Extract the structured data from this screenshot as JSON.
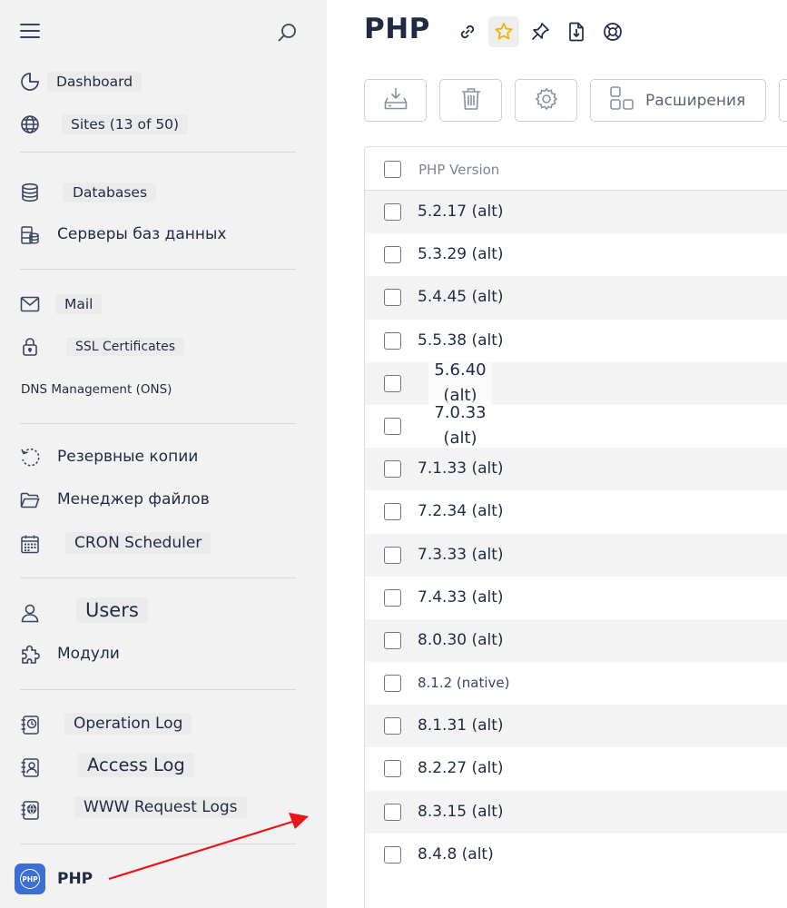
{
  "sidebar": {
    "items": [
      {
        "label": "Dashboard",
        "icon": "pie-chart-icon"
      },
      {
        "label": "Sites (13 of 50)",
        "icon": "globe-icon"
      },
      {
        "label": "Databases",
        "icon": "database-icon"
      },
      {
        "label": "Серверы баз данных",
        "icon": "database-server-icon"
      },
      {
        "label": "Mail",
        "icon": "envelope-icon"
      },
      {
        "label": "SSL Certificates",
        "icon": "lock-icon"
      },
      {
        "label": "DNS Management (ONS)",
        "icon": ""
      },
      {
        "label": "Резервные копии",
        "icon": "backup-icon"
      },
      {
        "label": "Менеджер файлов",
        "icon": "folder-icon"
      },
      {
        "label": "CRON Scheduler",
        "icon": "calendar-icon"
      },
      {
        "label": "Users",
        "icon": "user-icon"
      },
      {
        "label": "Модули",
        "icon": "puzzle-icon"
      },
      {
        "label": "Operation Log",
        "icon": "log-clock-icon"
      },
      {
        "label": "Access Log",
        "icon": "log-user-icon"
      },
      {
        "label": "WWW Request Logs",
        "icon": "log-globe-icon"
      },
      {
        "label": "PHP",
        "icon": "php-icon"
      }
    ],
    "php_badge_text": "PHP"
  },
  "main": {
    "title": "PHP",
    "extensions_label": "Расширения",
    "table": {
      "header": "PHP Version",
      "rows": [
        "5.2.17 (alt)",
        "5.3.29 (alt)",
        "5.4.45 (alt)",
        "5.5.38 (alt)",
        "5.6.40 (alt)",
        "7.0.33 (alt)",
        "7.1.33 (alt)",
        "7.2.34 (alt)",
        "7.3.33 (alt)",
        "7.4.33 (alt)",
        "8.0.30 (alt)",
        "8.1.2 (native)",
        "8.1.31 (alt)",
        "8.2.27 (alt)",
        "8.3.15 (alt)",
        "8.4.8 (alt)"
      ]
    }
  },
  "colors": {
    "sidebar_bg": "#f2f2f2",
    "text": "#1f2a44",
    "star_active": "#f0b400",
    "php_badge": "#3c6fd4",
    "annotation_arrow": "#e8161b"
  }
}
